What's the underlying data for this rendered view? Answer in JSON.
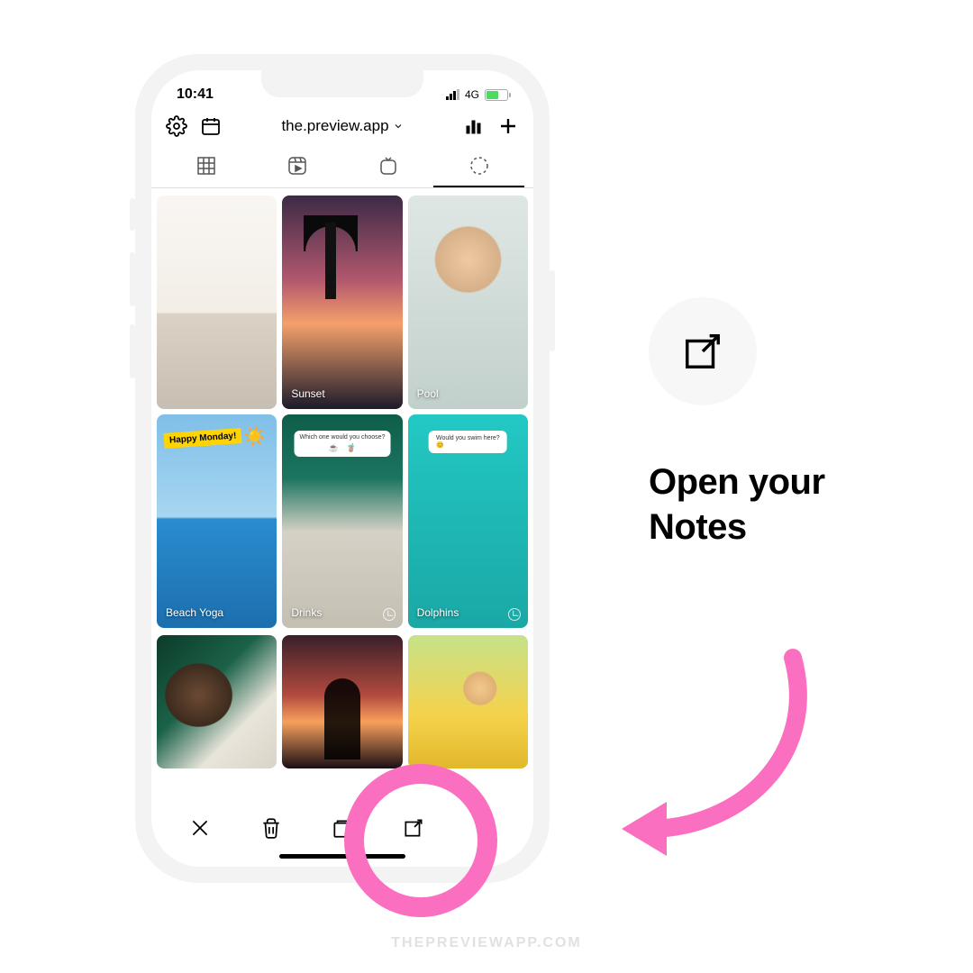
{
  "statusbar": {
    "time": "10:41",
    "network": "4G"
  },
  "header": {
    "title": "the.preview.app"
  },
  "cells": {
    "c2_label": "Sunset",
    "c3_label": "Pool",
    "c4_label": "Beach Yoga",
    "c4_tag": "Happy Monday!",
    "c5_label": "Drinks",
    "c5_poll_q": "Which one would you choose?",
    "c5_poll_a": "☕",
    "c5_poll_b": "🧋",
    "c6_label": "Dolphins",
    "c6_poll_q": "Would you swim here?",
    "c6_poll_a": "😊"
  },
  "sidepanel": {
    "cta_line1": "Open your",
    "cta_line2": "Notes"
  },
  "footer": {
    "watermark": "THEPREVIEWAPP.COM"
  }
}
